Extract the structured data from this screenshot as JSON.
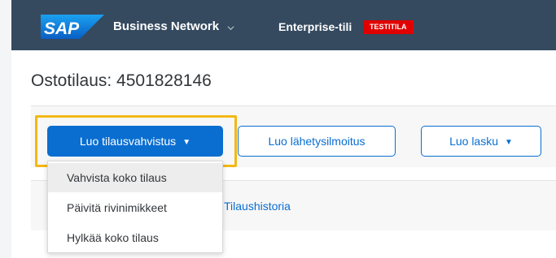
{
  "header": {
    "logo_text": "SAP",
    "brand": "Business Network",
    "account": "Enterprise-tili",
    "env_badge": "TESTITILA"
  },
  "page": {
    "title": "Ostotilaus: 4501828146"
  },
  "actions": {
    "confirm_label": "Luo tilausvahvistus",
    "ship_notice_label": "Luo lähetysilmoitus",
    "invoice_label": "Luo lasku"
  },
  "dropdown": {
    "items": [
      {
        "label": "Vahvista koko tilaus"
      },
      {
        "label": "Päivitä rivinimikkeet"
      },
      {
        "label": "Hylkää koko tilaus"
      }
    ]
  },
  "tabs": {
    "history": "Tilaushistoria"
  },
  "colors": {
    "shell": "#354a5f",
    "primary": "#0a6ed1",
    "highlight": "#f2b814",
    "badge": "#e00000"
  }
}
